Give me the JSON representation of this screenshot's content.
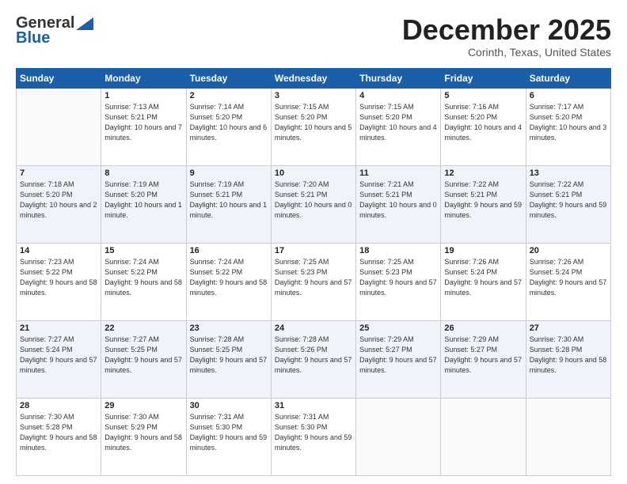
{
  "logo": {
    "line1": "General",
    "line2": "Blue"
  },
  "header": {
    "month": "December 2025",
    "location": "Corinth, Texas, United States"
  },
  "weekdays": [
    "Sunday",
    "Monday",
    "Tuesday",
    "Wednesday",
    "Thursday",
    "Friday",
    "Saturday"
  ],
  "weeks": [
    [
      {
        "day": null
      },
      {
        "day": 1,
        "sunrise": "7:13 AM",
        "sunset": "5:21 PM",
        "daylight": "10 hours and 7 minutes."
      },
      {
        "day": 2,
        "sunrise": "7:14 AM",
        "sunset": "5:20 PM",
        "daylight": "10 hours and 6 minutes."
      },
      {
        "day": 3,
        "sunrise": "7:15 AM",
        "sunset": "5:20 PM",
        "daylight": "10 hours and 5 minutes."
      },
      {
        "day": 4,
        "sunrise": "7:15 AM",
        "sunset": "5:20 PM",
        "daylight": "10 hours and 4 minutes."
      },
      {
        "day": 5,
        "sunrise": "7:16 AM",
        "sunset": "5:20 PM",
        "daylight": "10 hours and 4 minutes."
      },
      {
        "day": 6,
        "sunrise": "7:17 AM",
        "sunset": "5:20 PM",
        "daylight": "10 hours and 3 minutes."
      }
    ],
    [
      {
        "day": 7,
        "sunrise": "7:18 AM",
        "sunset": "5:20 PM",
        "daylight": "10 hours and 2 minutes."
      },
      {
        "day": 8,
        "sunrise": "7:19 AM",
        "sunset": "5:20 PM",
        "daylight": "10 hours and 1 minute."
      },
      {
        "day": 9,
        "sunrise": "7:19 AM",
        "sunset": "5:21 PM",
        "daylight": "10 hours and 1 minute."
      },
      {
        "day": 10,
        "sunrise": "7:20 AM",
        "sunset": "5:21 PM",
        "daylight": "10 hours and 0 minutes."
      },
      {
        "day": 11,
        "sunrise": "7:21 AM",
        "sunset": "5:21 PM",
        "daylight": "10 hours and 0 minutes."
      },
      {
        "day": 12,
        "sunrise": "7:22 AM",
        "sunset": "5:21 PM",
        "daylight": "9 hours and 59 minutes."
      },
      {
        "day": 13,
        "sunrise": "7:22 AM",
        "sunset": "5:21 PM",
        "daylight": "9 hours and 59 minutes."
      }
    ],
    [
      {
        "day": 14,
        "sunrise": "7:23 AM",
        "sunset": "5:22 PM",
        "daylight": "9 hours and 58 minutes."
      },
      {
        "day": 15,
        "sunrise": "7:24 AM",
        "sunset": "5:22 PM",
        "daylight": "9 hours and 58 minutes."
      },
      {
        "day": 16,
        "sunrise": "7:24 AM",
        "sunset": "5:22 PM",
        "daylight": "9 hours and 58 minutes."
      },
      {
        "day": 17,
        "sunrise": "7:25 AM",
        "sunset": "5:23 PM",
        "daylight": "9 hours and 57 minutes."
      },
      {
        "day": 18,
        "sunrise": "7:25 AM",
        "sunset": "5:23 PM",
        "daylight": "9 hours and 57 minutes."
      },
      {
        "day": 19,
        "sunrise": "7:26 AM",
        "sunset": "5:24 PM",
        "daylight": "9 hours and 57 minutes."
      },
      {
        "day": 20,
        "sunrise": "7:26 AM",
        "sunset": "5:24 PM",
        "daylight": "9 hours and 57 minutes."
      }
    ],
    [
      {
        "day": 21,
        "sunrise": "7:27 AM",
        "sunset": "5:24 PM",
        "daylight": "9 hours and 57 minutes."
      },
      {
        "day": 22,
        "sunrise": "7:27 AM",
        "sunset": "5:25 PM",
        "daylight": "9 hours and 57 minutes."
      },
      {
        "day": 23,
        "sunrise": "7:28 AM",
        "sunset": "5:25 PM",
        "daylight": "9 hours and 57 minutes."
      },
      {
        "day": 24,
        "sunrise": "7:28 AM",
        "sunset": "5:26 PM",
        "daylight": "9 hours and 57 minutes."
      },
      {
        "day": 25,
        "sunrise": "7:29 AM",
        "sunset": "5:27 PM",
        "daylight": "9 hours and 57 minutes."
      },
      {
        "day": 26,
        "sunrise": "7:29 AM",
        "sunset": "5:27 PM",
        "daylight": "9 hours and 57 minutes."
      },
      {
        "day": 27,
        "sunrise": "7:30 AM",
        "sunset": "5:28 PM",
        "daylight": "9 hours and 58 minutes."
      }
    ],
    [
      {
        "day": 28,
        "sunrise": "7:30 AM",
        "sunset": "5:28 PM",
        "daylight": "9 hours and 58 minutes."
      },
      {
        "day": 29,
        "sunrise": "7:30 AM",
        "sunset": "5:29 PM",
        "daylight": "9 hours and 58 minutes."
      },
      {
        "day": 30,
        "sunrise": "7:31 AM",
        "sunset": "5:30 PM",
        "daylight": "9 hours and 59 minutes."
      },
      {
        "day": 31,
        "sunrise": "7:31 AM",
        "sunset": "5:30 PM",
        "daylight": "9 hours and 59 minutes."
      },
      {
        "day": null
      },
      {
        "day": null
      },
      {
        "day": null
      }
    ]
  ]
}
